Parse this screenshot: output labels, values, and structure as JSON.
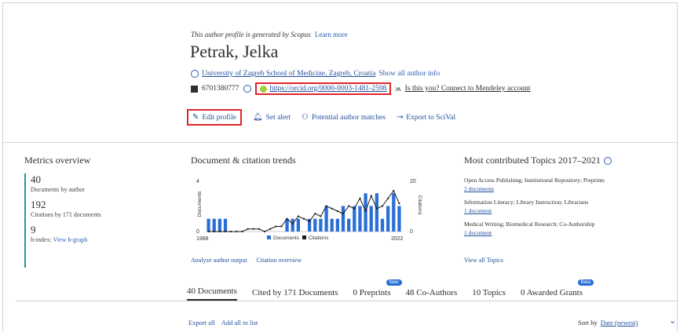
{
  "header": {
    "generated_note": "This author profile is generated by Scopus",
    "learn_more": "Learn more",
    "name": "Petrak, Jelka",
    "affiliation": "University of Zagreb School of Medicine, Zagreb, Croatia",
    "show_all_info": "Show all author info",
    "scopus_id": "6701380777",
    "orcid_url": "https://orcid.org/0000-0003-1481-2598",
    "mendeley": "Is this you? Connect to Mendeley account"
  },
  "actions": {
    "edit_profile": "Edit profile",
    "set_alert": "Set alert",
    "potential_matches": "Potential author matches",
    "export_scival": "Export to SciVal"
  },
  "metrics": {
    "title": "Metrics overview",
    "documents_value": "40",
    "documents_label": "Documents by author",
    "citations_value": "192",
    "citations_label": "Citations by 171 documents",
    "hindex_value": "9",
    "hindex_label": "h-index:",
    "hgraph_link": "View h-graph"
  },
  "trends": {
    "title": "Document & citation trends",
    "analyze_link": "Analyze author output",
    "citation_overview_link": "Citation overview"
  },
  "topics": {
    "title": "Most contributed Topics 2017–2021",
    "items": [
      {
        "name": "Open Access Publishing; Institutional Repository; Preprints",
        "docs": "2 documents"
      },
      {
        "name": "Information Literacy; Library Instruction; Librarians",
        "docs": "1 document"
      },
      {
        "name": "Medical Writing; Biomedical Research; Co-Authorship",
        "docs": "1 document"
      }
    ],
    "view_all": "View all Topics"
  },
  "tabs": [
    {
      "label": "40 Documents",
      "badge": ""
    },
    {
      "label": "Cited by 171 Documents",
      "badge": ""
    },
    {
      "label": "0 Preprints",
      "badge": "New"
    },
    {
      "label": "48 Co-Authors",
      "badge": ""
    },
    {
      "label": "10 Topics",
      "badge": ""
    },
    {
      "label": "0 Awarded Grants",
      "badge": "Beta"
    }
  ],
  "bottom": {
    "export_all": "Export all",
    "add_all": "Add all to list",
    "sort_label": "Sort by",
    "sort_value": "Date (newest)"
  },
  "colors": {
    "accent": "#1f4e9c",
    "highlight_box": "#e0262d",
    "bar": "#2a6fd6",
    "metrics_rule": "#1a9c9c"
  },
  "chart_data": {
    "type": "bar",
    "title": "Document & citation trends",
    "x_start_label": "1988",
    "x_end_label": "2022",
    "left_axis_label": "Documents",
    "right_axis_label": "Citations",
    "left_ticks": [
      "4",
      "0"
    ],
    "right_ticks": [
      "20",
      "0"
    ],
    "legend": [
      "Documents",
      "Citations"
    ],
    "categories": [
      1988,
      1989,
      1990,
      1991,
      1992,
      1993,
      1994,
      1995,
      1996,
      1997,
      1998,
      1999,
      2000,
      2001,
      2002,
      2003,
      2004,
      2005,
      2006,
      2007,
      2008,
      2009,
      2010,
      2011,
      2012,
      2013,
      2014,
      2015,
      2016,
      2017,
      2018,
      2019,
      2020,
      2021,
      2022
    ],
    "series": [
      {
        "name": "Documents",
        "values": [
          1,
          1,
          1,
          1,
          0,
          0,
          0,
          0,
          0,
          0,
          0,
          0,
          0,
          0,
          1,
          1,
          1,
          0,
          1,
          1,
          1,
          2,
          1,
          1,
          2,
          1,
          2,
          2,
          3,
          2,
          3,
          1,
          2,
          3,
          2
        ]
      },
      {
        "name": "Citations",
        "values": [
          0,
          0,
          0,
          0,
          0,
          0,
          0,
          1,
          1,
          1,
          0,
          1,
          2,
          2,
          5,
          3,
          6,
          5,
          4,
          7,
          6,
          10,
          9,
          8,
          7,
          10,
          9,
          13,
          8,
          14,
          9,
          10,
          13,
          16,
          11
        ]
      }
    ],
    "ylim_left": [
      0,
      4
    ],
    "ylim_right": [
      0,
      20
    ],
    "legend_position": "bottom"
  }
}
